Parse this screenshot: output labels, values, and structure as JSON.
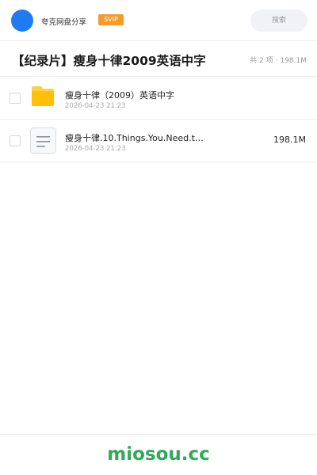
{
  "header": {
    "app_name": "夸克网盘分享",
    "badge": "SVIP",
    "search_placeholder": "搜索",
    "avatar_color": "#1f7bf2",
    "badge_color": "#f39a2b"
  },
  "share": {
    "title": "【纪录片】瘦身十律2009英语中字",
    "count_text": "共 2 项",
    "total_size": "198.1M"
  },
  "files": [
    {
      "type": "folder",
      "icon": "folder-icon",
      "name": "瘦身十律（2009）英语中字",
      "date": "2026-04-23 21:23",
      "size": ""
    },
    {
      "type": "file",
      "icon": "document-icon",
      "name": "瘦身十律.10.Things.You.Need.t…",
      "date": "2026-04-23 21:23",
      "size": "198.1M"
    }
  ],
  "footer": {
    "watermark": "miosou.cc",
    "watermark_color": "#2daa57"
  }
}
